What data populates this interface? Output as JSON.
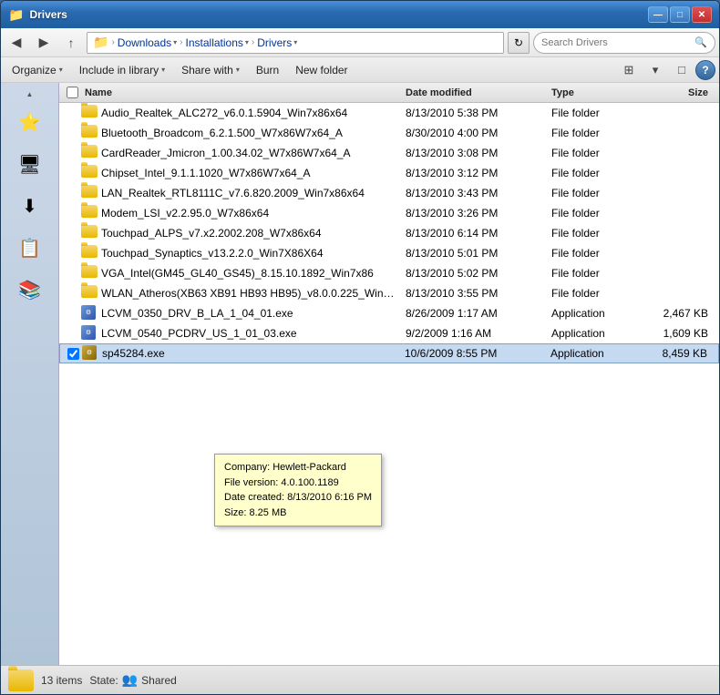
{
  "window": {
    "title": "Drivers",
    "title_buttons": {
      "minimize": "—",
      "maximize": "□",
      "close": "✕"
    }
  },
  "toolbar": {
    "back_label": "◀",
    "forward_label": "▶",
    "up_label": "↑",
    "breadcrumb": {
      "root_icon": "📁",
      "items": [
        {
          "label": "Downloads",
          "has_arrow": true
        },
        {
          "label": "Installations",
          "has_arrow": true
        },
        {
          "label": "Drivers",
          "has_arrow": true
        }
      ]
    },
    "refresh_label": "↻",
    "search_placeholder": "Search Drivers"
  },
  "menu_bar": {
    "items": [
      {
        "label": "Organize",
        "has_arrow": true
      },
      {
        "label": "Include in library",
        "has_arrow": true
      },
      {
        "label": "Share with",
        "has_arrow": true
      },
      {
        "label": "Burn"
      },
      {
        "label": "New folder"
      }
    ],
    "view_options": [
      "⊞",
      "▾"
    ],
    "layout_btn": "□",
    "help_btn": "?"
  },
  "columns": {
    "name": "Name",
    "date_modified": "Date modified",
    "type": "Type",
    "size": "Size"
  },
  "files": [
    {
      "name": "Audio_Realtek_ALC272_v6.0.1.5904_Win7x86x64",
      "date": "8/13/2010 5:38 PM",
      "type": "File folder",
      "size": "",
      "is_folder": true
    },
    {
      "name": "Bluetooth_Broadcom_6.2.1.500_W7x86W7x64_A",
      "date": "8/30/2010 4:00 PM",
      "type": "File folder",
      "size": "",
      "is_folder": true
    },
    {
      "name": "CardReader_Jmicron_1.00.34.02_W7x86W7x64_A",
      "date": "8/13/2010 3:08 PM",
      "type": "File folder",
      "size": "",
      "is_folder": true
    },
    {
      "name": "Chipset_Intel_9.1.1.1020_W7x86W7x64_A",
      "date": "8/13/2010 3:12 PM",
      "type": "File folder",
      "size": "",
      "is_folder": true
    },
    {
      "name": "LAN_Realtek_RTL8111C_v7.6.820.2009_Win7x86x64",
      "date": "8/13/2010 3:43 PM",
      "type": "File folder",
      "size": "",
      "is_folder": true
    },
    {
      "name": "Modem_LSI_v2.2.95.0_W7x86x64",
      "date": "8/13/2010 3:26 PM",
      "type": "File folder",
      "size": "",
      "is_folder": true
    },
    {
      "name": "Touchpad_ALPS_v7.x2.2002.208_W7x86x64",
      "date": "8/13/2010 6:14 PM",
      "type": "File folder",
      "size": "",
      "is_folder": true
    },
    {
      "name": "Touchpad_Synaptics_v13.2.2.0_Win7X86X64",
      "date": "8/13/2010 5:01 PM",
      "type": "File folder",
      "size": "",
      "is_folder": true
    },
    {
      "name": "VGA_Intel(GM45_GL40_GS45)_8.15.10.1892_Win7x86",
      "date": "8/13/2010 5:02 PM",
      "type": "File folder",
      "size": "",
      "is_folder": true
    },
    {
      "name": "WLAN_Atheros(XB63 XB91 HB93 HB95)_v8.0.0.225_Win7x...",
      "date": "8/13/2010 3:55 PM",
      "type": "File folder",
      "size": "",
      "is_folder": true
    },
    {
      "name": "LCVM_0350_DRV_B_LA_1_04_01.exe",
      "date": "8/26/2009 1:17 AM",
      "type": "Application",
      "size": "2,467 KB",
      "is_folder": false
    },
    {
      "name": "LCVM_0540_PCDRV_US_1_01_03.exe",
      "date": "9/2/2009 1:16 AM",
      "type": "Application",
      "size": "1,609 KB",
      "is_folder": false
    },
    {
      "name": "sp45284.exe",
      "date": "10/6/2009 8:55 PM",
      "type": "Application",
      "size": "8,459 KB",
      "is_folder": false,
      "selected": true
    }
  ],
  "tooltip": {
    "company": "Company: Hewlett-Packard",
    "version": "File version: 4.0.100.1189",
    "date": "Date created: 8/13/2010 6:16 PM",
    "size": "Size: 8.25 MB"
  },
  "status_bar": {
    "count": "13 items",
    "state_label": "State:",
    "shared_label": "Shared"
  },
  "sidebar": {
    "items": [
      {
        "icon": "⭐",
        "label": "Favorites"
      },
      {
        "icon": "🖥",
        "label": "Desktop"
      },
      {
        "icon": "⬇",
        "label": "Downloads"
      },
      {
        "icon": "📋",
        "label": "Recent"
      },
      {
        "icon": "📚",
        "label": "Libraries"
      }
    ]
  }
}
